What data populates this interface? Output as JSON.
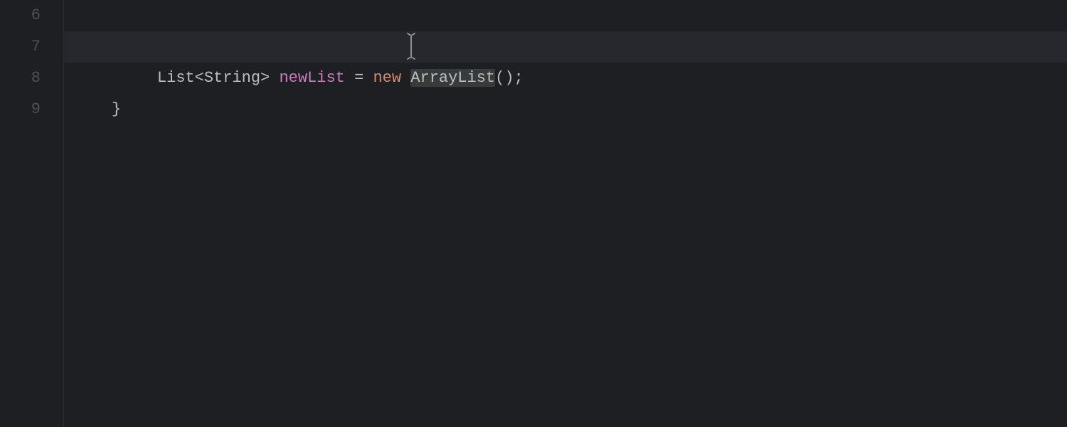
{
  "gutter": {
    "start": 6,
    "lines": [
      6,
      7,
      8,
      9
    ]
  },
  "code": {
    "line7": {
      "type_outer": "List",
      "type_inner": "String",
      "var_name": "newList",
      "op": " = ",
      "keyword_new": "new",
      "class_name": "ArrayList",
      "parens": "()",
      "semi": ";"
    },
    "line8": {
      "text": "}"
    }
  },
  "colors": {
    "bg": "#1e1f22",
    "current_line": "#26282e",
    "gutter_text": "#4b5059",
    "default_text": "#bcbec4",
    "keyword": "#cf8e6d",
    "variable": "#c77dbb",
    "border": "#2b2d30",
    "highlight": "#373b39"
  },
  "cursor": {
    "line": 7,
    "before_token": "ArrayList"
  }
}
